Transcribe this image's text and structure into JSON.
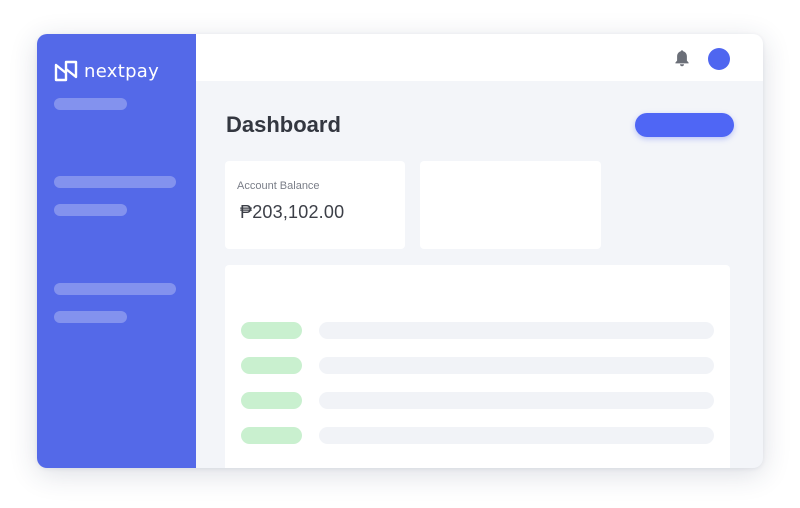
{
  "app": {
    "brand_name": "nextpay",
    "logo_icon": "nextpay-logo-icon"
  },
  "header": {
    "notifications_icon": "bell-icon",
    "avatar_icon": "avatar-circle"
  },
  "main": {
    "title": "Dashboard"
  },
  "cards": {
    "balance_label": "Account Balance",
    "balance_value": "₱203,102.00"
  },
  "colors": {
    "sidebar": "#5469e8",
    "accent": "#4f66f5",
    "status_green": "#c9f0cf",
    "background": "#f3f5f9"
  }
}
